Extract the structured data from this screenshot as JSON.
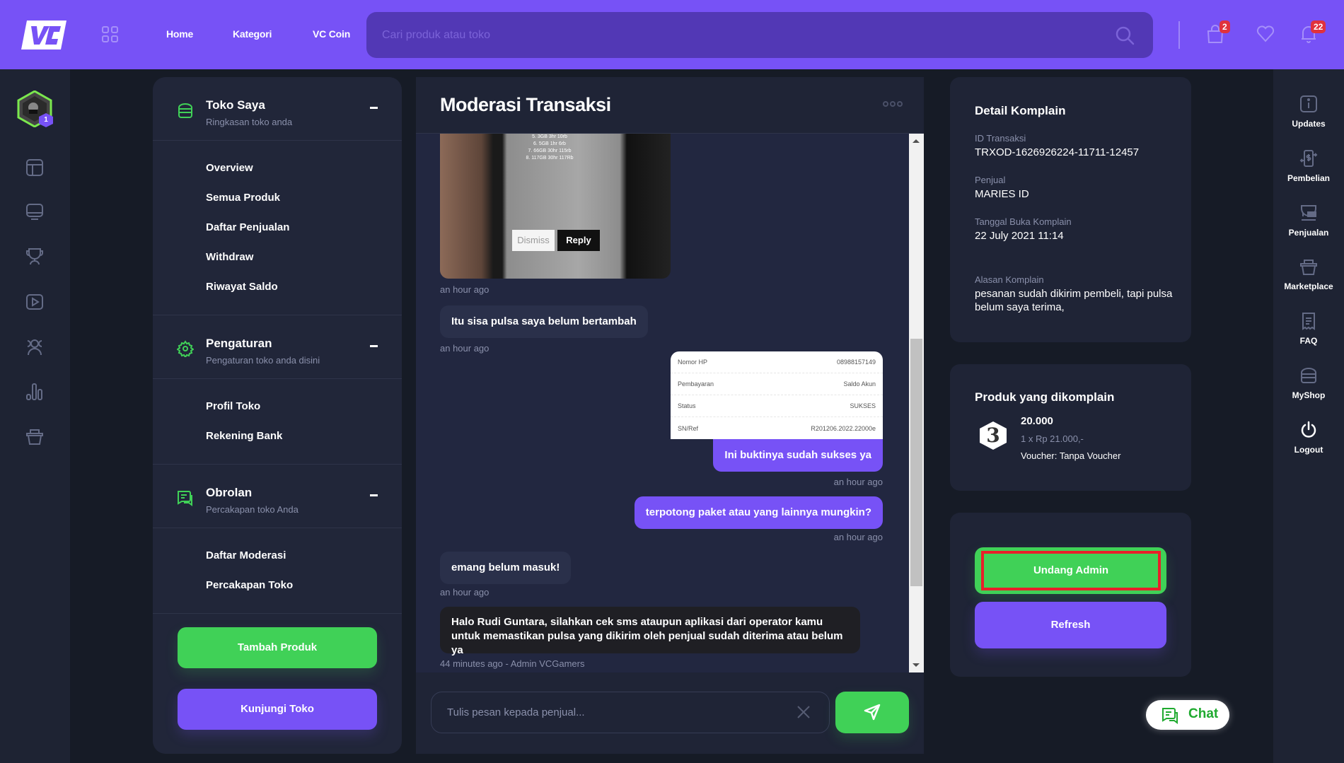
{
  "topbar": {
    "logo_text": "VC",
    "nav": [
      "Home",
      "Kategori",
      "VC Coin"
    ],
    "search_placeholder": "Cari produk atau toko",
    "cart_count": "2",
    "notification_count": "22"
  },
  "left_rail": {
    "avatar_level": "1",
    "icons": [
      "layout-icon",
      "monitor-icon",
      "trophy-icon",
      "play-icon",
      "users-icon",
      "chart-icon",
      "basket-icon"
    ]
  },
  "menu": {
    "sections": [
      {
        "title": "Toko Saya",
        "subtitle": "Ringkasan toko anda",
        "items": [
          "Overview",
          "Semua Produk",
          "Daftar Penjualan",
          "Withdraw",
          "Riwayat Saldo"
        ]
      },
      {
        "title": "Pengaturan",
        "subtitle": "Pengaturan toko anda disini",
        "items": [
          "Profil Toko",
          "Rekening Bank"
        ]
      },
      {
        "title": "Obrolan",
        "subtitle": "Percakapan toko Anda",
        "items": [
          "Daftar Moderasi",
          "Percakapan Toko"
        ]
      }
    ],
    "add_product_label": "Tambah Produk",
    "visit_shop_label": "Kunjungi Toko"
  },
  "chat": {
    "title": "Moderasi Transaksi",
    "image_message": {
      "phone_text": [
        "5. 3GB 3hr 10rb",
        "6. 5GB 1hr 6rb",
        "7. 66GB 30hr 115rb",
        "8. 117GB 30hr 117Rb"
      ],
      "dismiss": "Dismiss",
      "reply": "Reply",
      "time": "an hour ago"
    },
    "messages": [
      {
        "side": "in",
        "text": "Itu sisa pulsa saya belum bertambah",
        "time": "an hour ago"
      },
      {
        "side": "out",
        "text": "Ini buktinya sudah sukses ya",
        "time": "an hour ago"
      },
      {
        "side": "out",
        "text": "terpotong paket atau yang lainnya mungkin?",
        "time": "an hour ago"
      },
      {
        "side": "in",
        "text": "emang belum masuk!",
        "time": "an hour ago"
      },
      {
        "side": "admin",
        "text": "Halo Rudi Guntara, silahkan cek sms ataupun aplikasi dari operator kamu untuk memastikan pulsa yang dikirim oleh penjual sudah diterima atau belum ya",
        "time": "44 minutes ago - Admin VCGamers"
      }
    ],
    "receipt": [
      {
        "label": "Nomor HP",
        "value": "08988157149"
      },
      {
        "label": "Pembayaran",
        "value": "Saldo Akun"
      },
      {
        "label": "Status",
        "value": "SUKSES"
      },
      {
        "label": "SN/Ref",
        "value": "R201206.2022.22000e"
      }
    ],
    "input_placeholder": "Tulis pesan kepada penjual..."
  },
  "complaint": {
    "title": "Detail Komplain",
    "fields": [
      {
        "label": "ID Transaksi",
        "value": "TRXOD-1626926224-11711-12457"
      },
      {
        "label": "Penjual",
        "value": "MARIES ID"
      },
      {
        "label": "Tanggal Buka Komplain",
        "value": "22 July 2021 11:14"
      },
      {
        "label": "Alasan Komplain",
        "value": "pesanan sudah dikirim pembeli, tapi pulsa belum saya terima,"
      }
    ]
  },
  "product": {
    "title": "Produk yang dikomplain",
    "name": "20.000",
    "price": "1 x Rp 21.000,-",
    "voucher": "Voucher: Tanpa Voucher",
    "thumb_glyph": "3"
  },
  "actions": {
    "invite_admin": "Undang Admin",
    "refresh": "Refresh"
  },
  "chat_float_label": "Chat",
  "right_rail": [
    "Updates",
    "Pembelian",
    "Penjualan",
    "Marketplace",
    "FAQ",
    "MyShop",
    "Logout"
  ],
  "colors": {
    "primary": "#7752f6",
    "success": "#40d157",
    "danger": "#e0323d",
    "highlight": "#e8202a"
  }
}
